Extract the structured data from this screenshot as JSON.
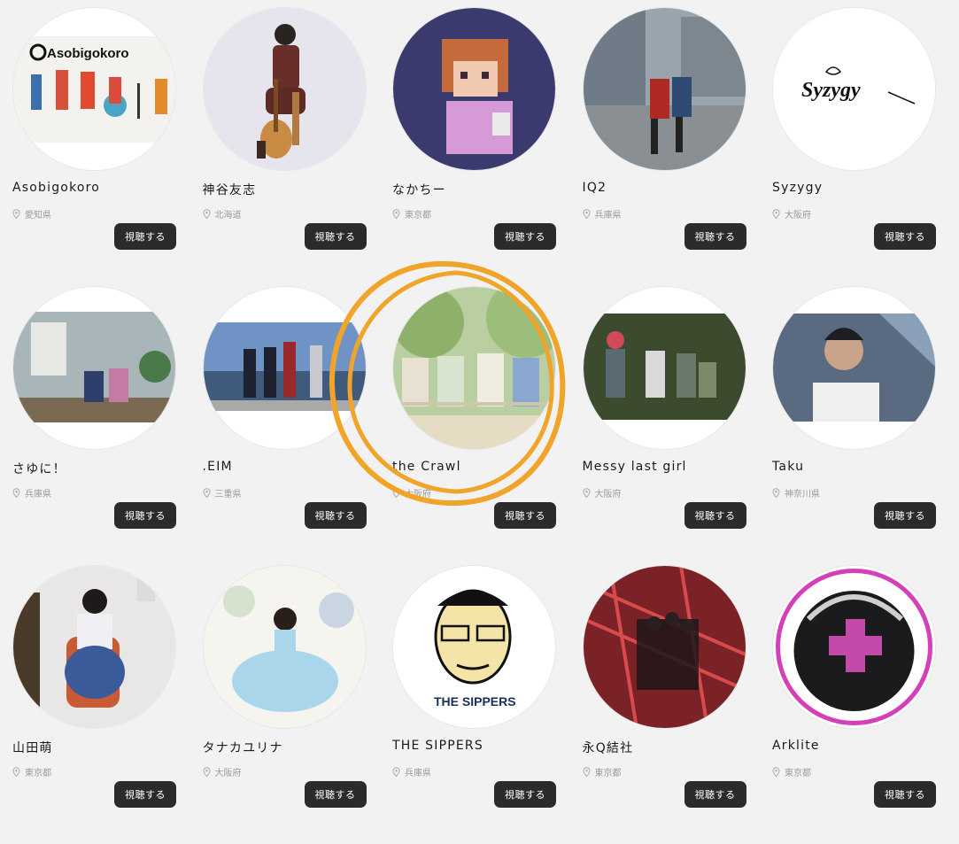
{
  "listen_label": "視聴する",
  "highlight_color": "#f0a429",
  "artists": [
    {
      "name": "Asobigokoro",
      "location": "愛知県",
      "logo_text": "Asobigokoro"
    },
    {
      "name": "神谷友志",
      "location": "北海道"
    },
    {
      "name": "なかちー",
      "location": "東京都"
    },
    {
      "name": "IQ2",
      "location": "兵庫県"
    },
    {
      "name": "Syzygy",
      "location": "大阪府",
      "logo_text": "Syzygy"
    },
    {
      "name": "さゆに！",
      "location": "兵庫県"
    },
    {
      "name": ".EIM",
      "location": "三重県"
    },
    {
      "name": "the Crawl",
      "location": "大阪府"
    },
    {
      "name": "Messy last girl",
      "location": "大阪府"
    },
    {
      "name": "Taku",
      "location": "神奈川県"
    },
    {
      "name": "山田萌",
      "location": "東京都"
    },
    {
      "name": "タナカユリナ",
      "location": "大阪府"
    },
    {
      "name": "THE SIPPERS",
      "location": "兵庫県",
      "logo_text": "THE SIPPERS"
    },
    {
      "name": "永Q結社",
      "location": "東京都"
    },
    {
      "name": "Arklite",
      "location": "東京都"
    }
  ]
}
